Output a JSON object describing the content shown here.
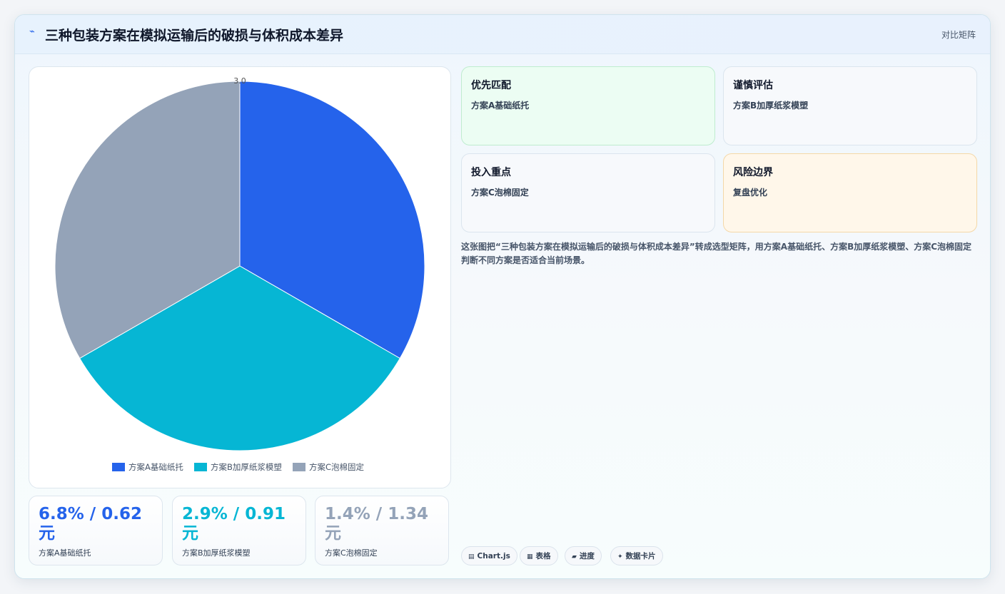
{
  "header": {
    "title": "三种包装方案在模拟运输后的破损与体积成本差异",
    "tag": "对比矩阵"
  },
  "chart_data": {
    "type": "pie",
    "categories": [
      "方案A基础纸托",
      "方案B加厚纸浆模塑",
      "方案C泡棉固定"
    ],
    "values": [
      1,
      1,
      1
    ],
    "colors": [
      "#2563eb",
      "#06b6d4",
      "#94a3b8"
    ],
    "top_label": "3.0",
    "legend_position": "bottom"
  },
  "kpis": [
    {
      "value": "6.8% / 0.62 元",
      "label": "方案A基础纸托",
      "color": "#2563eb"
    },
    {
      "value": "2.9% / 0.91 元",
      "label": "方案B加厚纸浆模塑",
      "color": "#06b6d4"
    },
    {
      "value": "1.4% / 1.34 元",
      "label": "方案C泡棉固定",
      "color": "#94a3b8"
    }
  ],
  "cards": [
    {
      "title": "优先匹配",
      "desc": "方案A基础纸托"
    },
    {
      "title": "谨慎评估",
      "desc": "方案B加厚纸浆模塑"
    },
    {
      "title": "投入重点",
      "desc": "方案C泡棉固定"
    },
    {
      "title": "风险边界",
      "desc": "复盘优化"
    }
  ],
  "description": "这张图把“三种包装方案在模拟运输后的破损与体积成本差异”转成选型矩阵，用方案A基础纸托、方案B加厚纸浆模塑、方案C泡棉固定判断不同方案是否适合当前场景。",
  "chips": [
    {
      "icon": "▤",
      "label": "Chart.js"
    },
    {
      "icon": "▦",
      "label": "表格"
    },
    {
      "icon": "▰",
      "label": "进度"
    },
    {
      "icon": "✦",
      "label": "数据卡片"
    }
  ]
}
